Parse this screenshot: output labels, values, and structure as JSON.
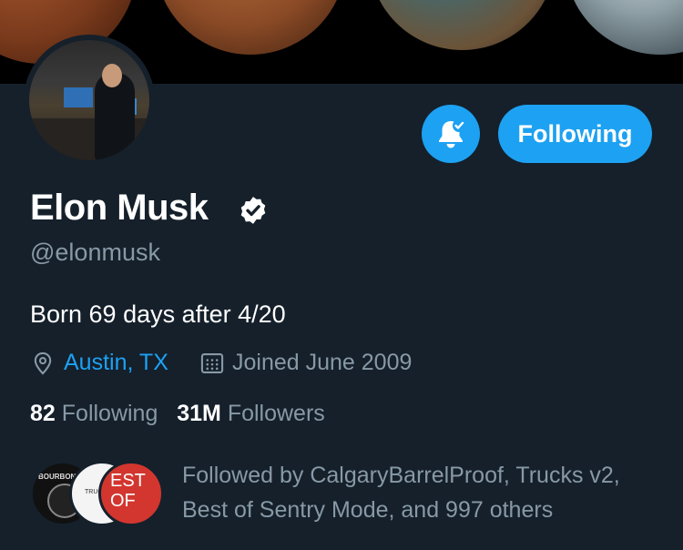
{
  "banner": {
    "alt": "planet-banner"
  },
  "profile": {
    "name": "Elon Musk",
    "handle": "@elonmusk",
    "bio": "Born 69 days after 4/20",
    "location": "Austin, TX",
    "joined": "Joined June 2009",
    "verified": true
  },
  "actions": {
    "notifications_icon": "bell-check-icon",
    "follow_label": "Following"
  },
  "stats": {
    "following_count": "82",
    "following_label": "Following",
    "followers_count": "31M",
    "followers_label": "Followers"
  },
  "followed_by": {
    "text": "Followed by CalgaryBarrelProof, Trucks v2, Best of Sentry Mode, and 997 others",
    "avatars": [
      {
        "name": "CalgaryBarrelProof",
        "label": "BOURBON"
      },
      {
        "name": "Trucks v2",
        "label": "TRUCKS"
      },
      {
        "name": "Best of Sentry Mode",
        "label": "EST OF"
      }
    ]
  },
  "colors": {
    "background": "#15202b",
    "accent": "#1da1f2",
    "secondary_text": "#8899a6"
  }
}
